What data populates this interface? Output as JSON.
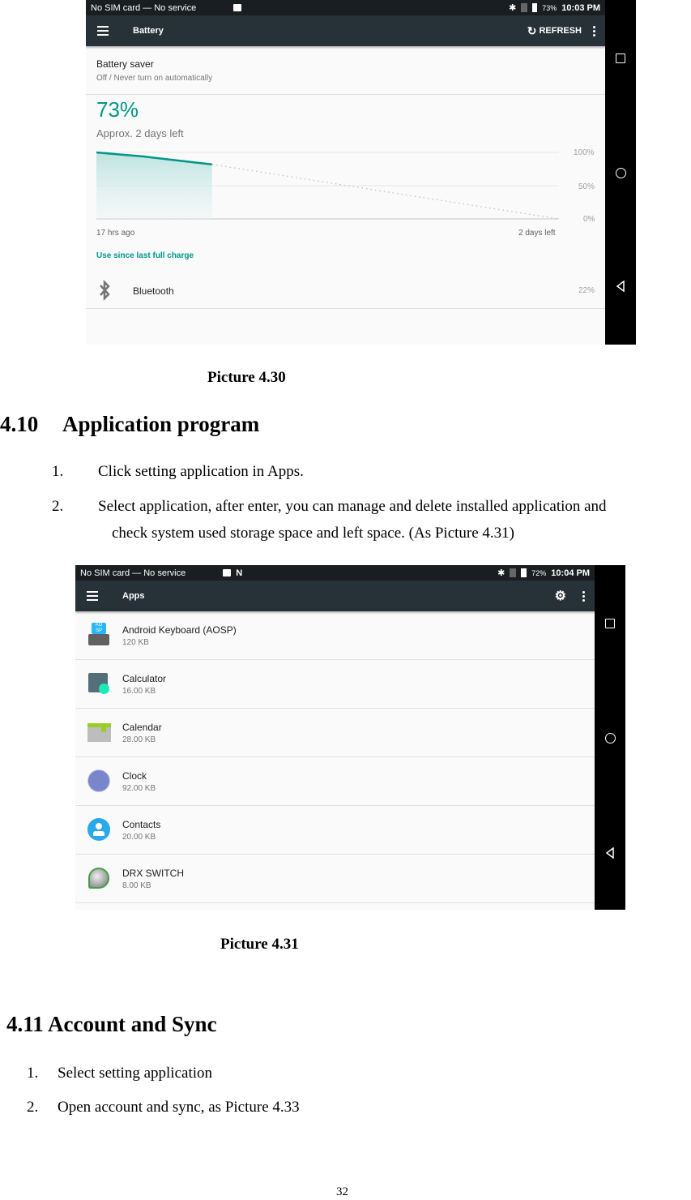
{
  "battery_screen": {
    "status_bar": {
      "carrier": "No SIM card — No service",
      "battery": "73%",
      "time": "10:03 PM"
    },
    "toolbar": {
      "title": "Battery",
      "refresh_label": "REFRESH"
    },
    "battery_saver": {
      "title": "Battery saver",
      "subtitle": "Off / Never turn on automatically"
    },
    "level": "73%",
    "remaining": "Approx. 2 days left",
    "chart_labels": {
      "y_100": "100%",
      "y_50": "50%",
      "y_0": "0%",
      "x_start": "17 hrs ago",
      "x_end": "2 days left"
    },
    "use_since_label": "Use since last full charge",
    "usage": [
      {
        "name": "Bluetooth",
        "percent": "22%"
      }
    ]
  },
  "chart_data": {
    "type": "line",
    "title": "",
    "xlabel": "",
    "ylabel": "",
    "ylim": [
      0,
      100
    ],
    "y_ticks": [
      "100%",
      "50%",
      "0%"
    ],
    "x_ticks": [
      "17 hrs ago",
      "2 days left"
    ],
    "series": [
      {
        "name": "history",
        "style": "solid-filled",
        "x": [
          0,
          0.05,
          0.1,
          0.15,
          0.2,
          0.25
        ],
        "values": [
          100,
          97,
          94,
          90,
          86,
          82
        ]
      },
      {
        "name": "projection",
        "style": "dotted",
        "x": [
          0.25,
          1.0
        ],
        "values": [
          82,
          0
        ]
      }
    ]
  },
  "apps_screen": {
    "status_bar": {
      "carrier": "No SIM card — No service",
      "battery": "72%",
      "time": "10:04 PM"
    },
    "toolbar": {
      "title": "Apps"
    },
    "apps": [
      {
        "name": "Android Keyboard (AOSP)",
        "size": "120 KB",
        "icon": "keyboard-icon"
      },
      {
        "name": "Calculator",
        "size": "16.00 KB",
        "icon": "calculator-icon"
      },
      {
        "name": "Calendar",
        "size": "28.00 KB",
        "icon": "calendar-icon"
      },
      {
        "name": "Clock",
        "size": "92.00 KB",
        "icon": "clock-icon"
      },
      {
        "name": "Contacts",
        "size": "20.00 KB",
        "icon": "contacts-icon"
      },
      {
        "name": "DRX SWITCH",
        "size": "8.00 KB",
        "icon": "drx-switch-icon"
      }
    ]
  },
  "document": {
    "caption1": "Picture 4.30",
    "section1": {
      "number": "4.10",
      "title": "Application program"
    },
    "steps1": [
      {
        "num": "1.",
        "text": "Click setting application in Apps."
      },
      {
        "num": "2.",
        "text": "Select application, after enter, you can manage and delete installed application and",
        "cont": "check system used storage space and left space. (As Picture 4.31)"
      }
    ],
    "caption2": "Picture 4.31",
    "section2": {
      "title": "4.11 Account and Sync"
    },
    "steps2": [
      {
        "num": "1.",
        "text": "Select setting application"
      },
      {
        "num": "2.",
        "text": "Open account and sync, as Picture 4.33"
      }
    ],
    "page_number": "32"
  },
  "colors": {
    "accent": "#009688",
    "toolbar": "#263238",
    "statusbar": "#1a1e20"
  }
}
